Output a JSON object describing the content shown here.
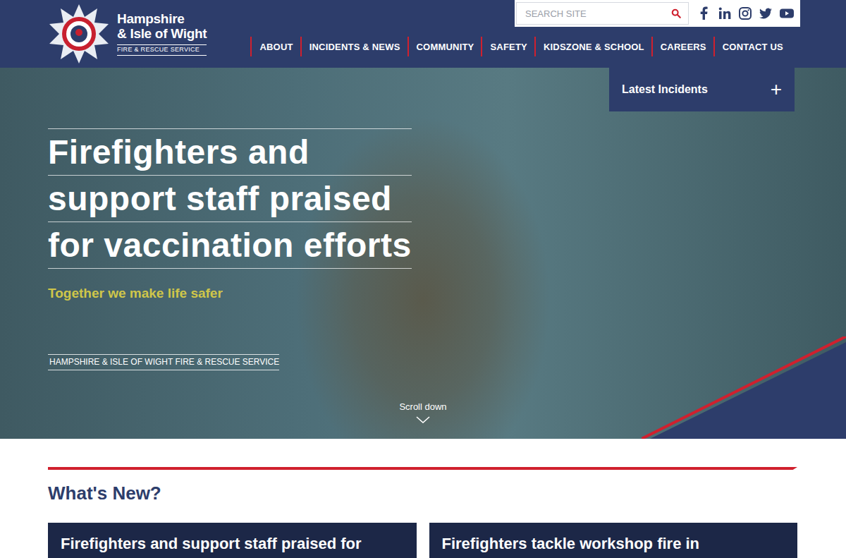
{
  "logo": {
    "line1": "Hampshire",
    "line2": "& Isle of Wight",
    "line3": "FIRE & RESCUE SERVICE"
  },
  "search": {
    "placeholder": "SEARCH SITE"
  },
  "nav": [
    "ABOUT",
    "INCIDENTS & NEWS",
    "COMMUNITY",
    "SAFETY",
    "KIDSZONE & SCHOOL",
    "CAREERS",
    "CONTACT US"
  ],
  "incidents_panel": {
    "label": "Latest Incidents",
    "toggle": "+"
  },
  "hero": {
    "headline": [
      "Firefighters and",
      "support staff praised",
      "for vaccination efforts"
    ],
    "tagline": "Together we make life safer",
    "org": "HAMPSHIRE & ISLE OF WIGHT FIRE & RESCUE SERVICE",
    "scroll": "Scroll down"
  },
  "whats_new": {
    "heading": "What's New?",
    "cards": [
      {
        "title": "Firefighters and support staff praised for"
      },
      {
        "title": "Firefighters tackle workshop fire in"
      }
    ]
  }
}
